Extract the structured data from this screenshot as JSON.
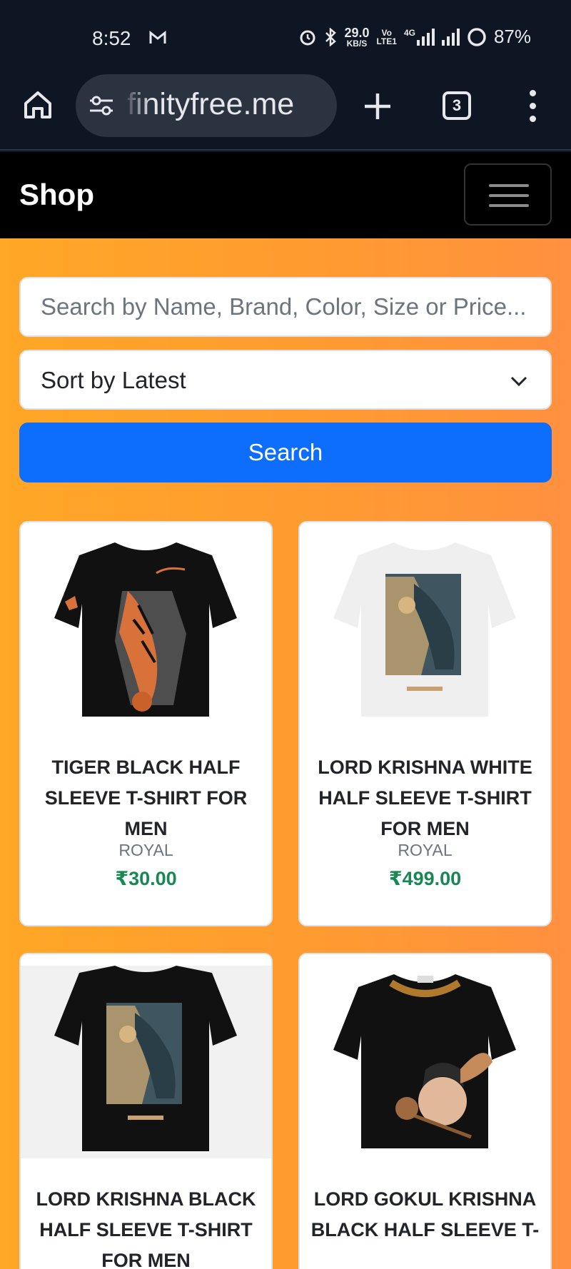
{
  "status_bar": {
    "time": "8:52",
    "net_speed_top": "29.0",
    "net_speed_bottom": "KB/S",
    "volte_top": "Vo",
    "volte_bottom": "LTE1",
    "network": "4G",
    "battery": "87%"
  },
  "browser": {
    "url": "finityfree.me",
    "tab_count": "3"
  },
  "navbar": {
    "brand": "Shop"
  },
  "filters": {
    "search_placeholder": "Search by Name, Brand, Color, Size or Price...",
    "sort_selected": "Sort by Latest",
    "search_button": "Search"
  },
  "products": [
    {
      "name": "TIGER BLACK HALF SLEEVE T-SHIRT FOR MEN",
      "brand": "ROYAL",
      "price": "₹30.00"
    },
    {
      "name": "LORD KRISHNA WHITE HALF SLEEVE T-SHIRT FOR MEN",
      "brand": "ROYAL",
      "price": "₹499.00"
    },
    {
      "name": "LORD KRISHNA BLACK HALF SLEEVE T-SHIRT FOR MEN",
      "brand": "",
      "price": ""
    },
    {
      "name": "LORD GOKUL KRISHNA BLACK HALF SLEEVE T-",
      "brand": "",
      "price": ""
    }
  ],
  "colors": {
    "accent": "#0d6efd",
    "price": "#198754",
    "navbar": "#000000",
    "background_orange": "#ffa726"
  }
}
